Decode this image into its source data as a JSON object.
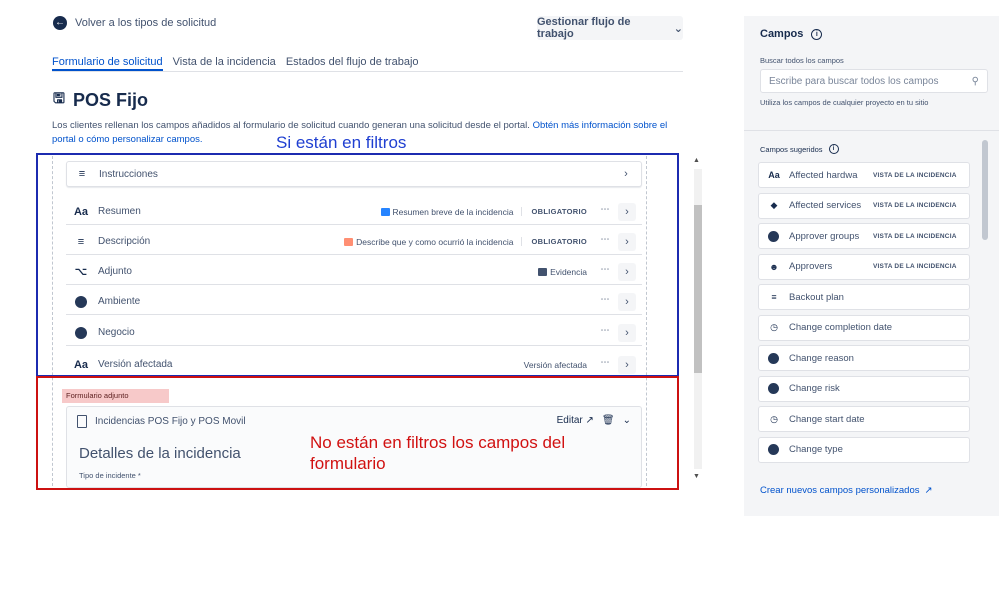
{
  "header": {
    "back_label": "Volver a los tipos de solicitud",
    "manage_workflow": "Gestionar flujo de trabajo"
  },
  "tabs": [
    {
      "label": "Formulario de solicitud",
      "active": true
    },
    {
      "label": "Vista de la incidencia",
      "active": false
    },
    {
      "label": "Estados del flujo de trabajo",
      "active": false
    }
  ],
  "page": {
    "title": "POS Fijo",
    "desc_text": "Los clientes rellenan los campos añadidos al formulario de solicitud cuando generan una solicitud desde el portal.",
    "desc_link": "Obtén más información sobre el portal o cómo personalizar campos."
  },
  "annotations": {
    "blue_note": "Si están en filtros",
    "red_note": "No están en filtros los campos del formulario"
  },
  "fields": [
    {
      "label": "Instrucciones",
      "icon": "lines-icon",
      "hint": "",
      "badge": ""
    },
    {
      "label": "Resumen",
      "icon": "text-icon",
      "hint": "Resumen breve de la incidencia",
      "badge": "OBLIGATORIO"
    },
    {
      "label": "Descripción",
      "icon": "lines-icon",
      "hint": "Describe que y como ocurrió la incidencia",
      "badge": "OBLIGATORIO"
    },
    {
      "label": "Adjunto",
      "icon": "paperclip-icon",
      "hint": "Evidencia",
      "badge": ""
    },
    {
      "label": "Ambiente",
      "icon": "dropdown-icon",
      "hint": "",
      "badge": ""
    },
    {
      "label": "Negocio",
      "icon": "dropdown-icon",
      "hint": "",
      "badge": ""
    },
    {
      "label": "Versión afectada",
      "icon": "text-icon",
      "hint": "Versión afectada",
      "badge": ""
    }
  ],
  "attached_form": {
    "tag": "Formulario adjunto",
    "name": "Incidencias POS Fijo y POS Movil",
    "edit_label": "Editar",
    "section_title": "Detalles de la incidencia",
    "first_field": "Tipo de incidente *"
  },
  "panel": {
    "title": "Campos",
    "search_label": "Buscar todos los campos",
    "search_placeholder": "Escribe para buscar todos los campos",
    "help_text": "Utiliza los campos de cualquier proyecto en tu sitio",
    "suggested_title": "Campos sugeridos",
    "items": [
      {
        "label": "Affected hardwa",
        "icon": "text-icon",
        "tag": "VISTA DE LA INCIDENCIA"
      },
      {
        "label": "Affected services",
        "icon": "service-icon",
        "tag": "VISTA DE LA INCIDENCIA"
      },
      {
        "label": "Approver groups",
        "icon": "dropdown-icon",
        "tag": "VISTA DE LA INCIDENCIA"
      },
      {
        "label": "Approvers",
        "icon": "user-icon",
        "tag": "VISTA DE LA INCIDENCIA"
      },
      {
        "label": "Backout plan",
        "icon": "lines-icon",
        "tag": ""
      },
      {
        "label": "Change completion date",
        "icon": "clock-icon",
        "tag": ""
      },
      {
        "label": "Change reason",
        "icon": "dropdown-icon",
        "tag": ""
      },
      {
        "label": "Change risk",
        "icon": "dropdown-icon",
        "tag": ""
      },
      {
        "label": "Change start date",
        "icon": "clock-icon",
        "tag": ""
      },
      {
        "label": "Change type",
        "icon": "dropdown-icon",
        "tag": ""
      }
    ],
    "create_link": "Crear nuevos campos personalizados"
  },
  "colors": {
    "blue_box": "#1c2bb0",
    "red_box": "#cc1111",
    "link": "#0052cc",
    "attached_tag_bg": "#f7c9c9"
  }
}
